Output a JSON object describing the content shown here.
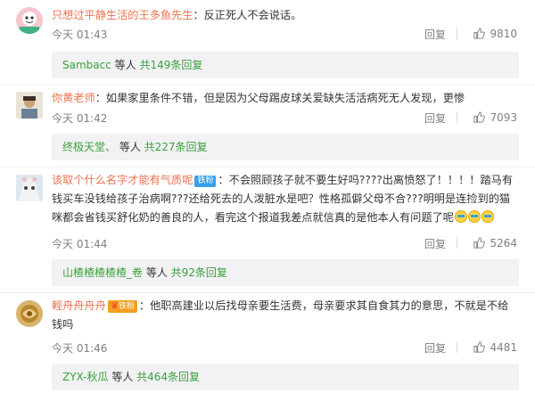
{
  "comments": [
    {
      "username": "只想过平静生活的王多鱼先生",
      "badge": "",
      "text": "：反正死人不会说话。",
      "time": "今天 01:43",
      "reply_label": "回复",
      "likes": "9810",
      "sub": {
        "user": "Sambacc",
        "mid": " 等人 ",
        "count": "共149条回复"
      }
    },
    {
      "username": "你黄老师",
      "badge": "",
      "text": "：如果家里条件不错，但是因为父母踢皮球关爱缺失活活病死无人发现，更惨",
      "time": "今天 01:42",
      "reply_label": "回复",
      "likes": "7093",
      "sub": {
        "user": "终极天堂、",
        "mid": " 等人 ",
        "count": "共227条回复"
      }
    },
    {
      "username": "该取个什么名字才能有气质呢",
      "badge": "铁粉",
      "text": "：不会照顾孩子就不要生好吗????出离愤怒了！！！！踏马有钱买车没钱给孩子治病啊???还给死去的人泼脏水是吧？性格孤僻父母不合???明明是连捡到的猫咪都会省钱买舒化奶的善良的人，看完这个报道我差点就信真的是他本人有问题了呢",
      "time": "今天 01:44",
      "reply_label": "回复",
      "likes": "5264",
      "sub": {
        "user": "山楂楂楂楂楂_卷",
        "mid": " 等人 ",
        "count": "共92条回复"
      }
    },
    {
      "username": "輕舟舟舟舟",
      "badge": "铁粉",
      "text": "：他职高建业以后找母亲要生活费，母亲要求其自食其力的意思，不就是不给钱吗",
      "time": "今天 01:46",
      "reply_label": "回复",
      "likes": "4481",
      "sub": {
        "user": "ZYX-秋瓜",
        "mid": " 等人 ",
        "count": "共464条回复"
      }
    }
  ]
}
